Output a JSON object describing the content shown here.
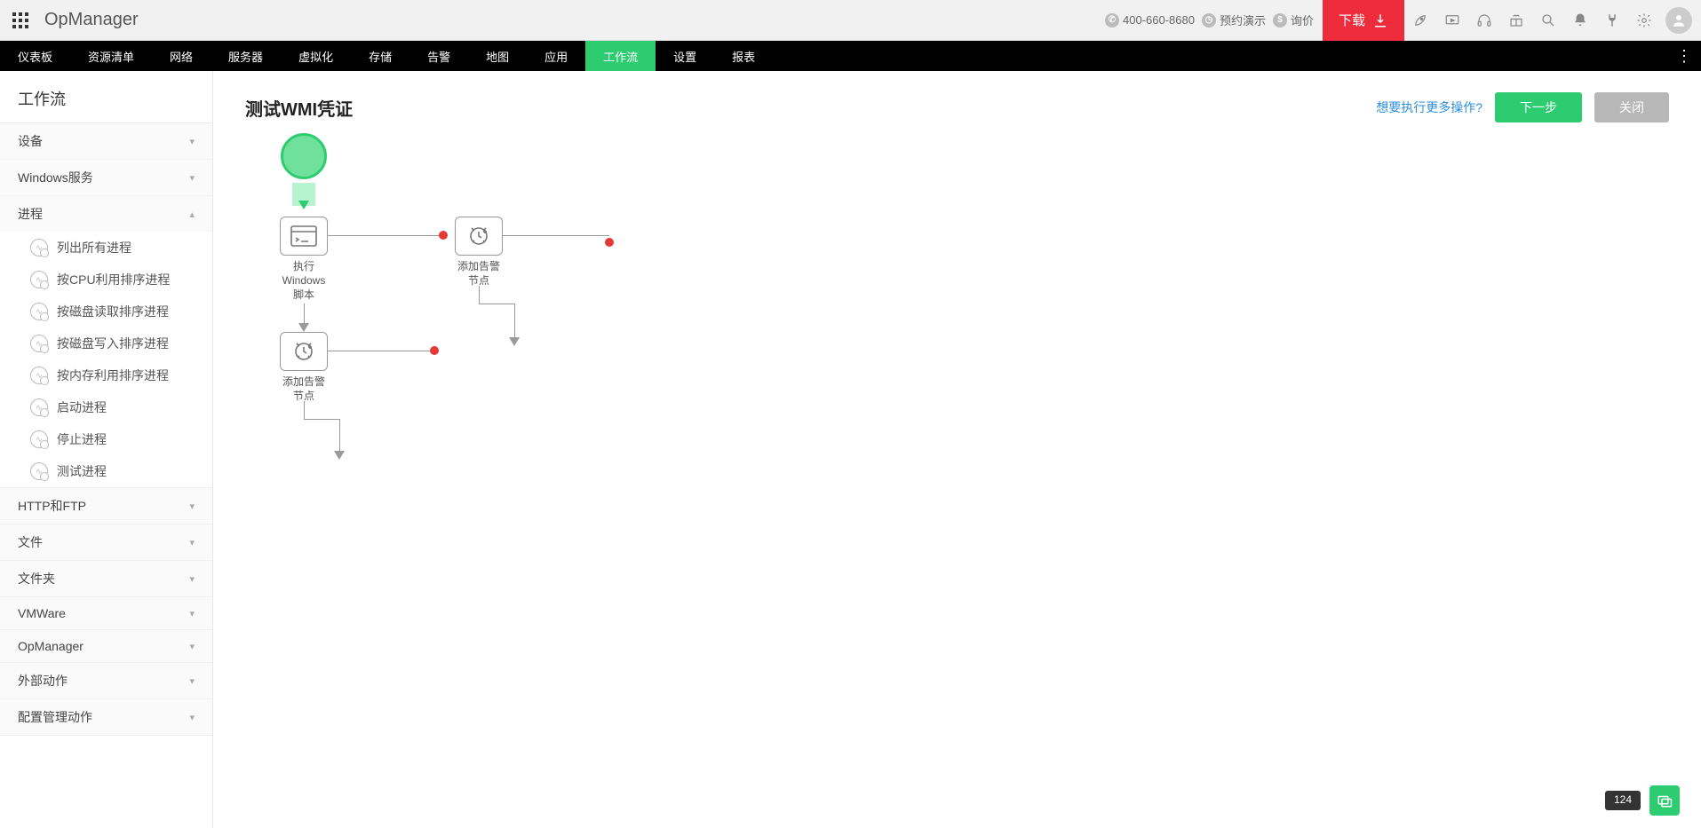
{
  "header": {
    "brand": "OpManager",
    "phone": "400-660-8680",
    "demo": "预约演示",
    "inquiry": "询价",
    "download": "下载"
  },
  "nav": {
    "items": [
      "仪表板",
      "资源清单",
      "网络",
      "服务器",
      "虚拟化",
      "存储",
      "告警",
      "地图",
      "应用",
      "工作流",
      "设置",
      "报表"
    ],
    "active_index": 9
  },
  "sidebar": {
    "title": "工作流",
    "groups": [
      {
        "label": "设备",
        "expanded": false
      },
      {
        "label": "Windows服务",
        "expanded": false
      },
      {
        "label": "进程",
        "expanded": true,
        "items": [
          "列出所有进程",
          "按CPU利用排序进程",
          "按磁盘读取排序进程",
          "按磁盘写入排序进程",
          "按内存利用排序进程",
          "启动进程",
          "停止进程",
          "测试进程"
        ]
      },
      {
        "label": "HTTP和FTP",
        "expanded": false
      },
      {
        "label": "文件",
        "expanded": false
      },
      {
        "label": "文件夹",
        "expanded": false
      },
      {
        "label": "VMWare",
        "expanded": false
      },
      {
        "label": "OpManager",
        "expanded": false
      },
      {
        "label": "外部动作",
        "expanded": false
      },
      {
        "label": "配置管理动作",
        "expanded": false
      }
    ]
  },
  "content": {
    "title": "测试WMI凭证",
    "more_link": "想要执行更多操作?",
    "next_btn": "下一步",
    "close_btn": "关闭"
  },
  "workflow": {
    "node1": {
      "line1": "执行",
      "line2": "Windows",
      "line3": "脚本"
    },
    "node2": {
      "line1": "添加告警",
      "line2": "节点"
    },
    "node3": {
      "line1": "添加告警",
      "line2": "节点"
    }
  },
  "footer": {
    "count": "124"
  }
}
